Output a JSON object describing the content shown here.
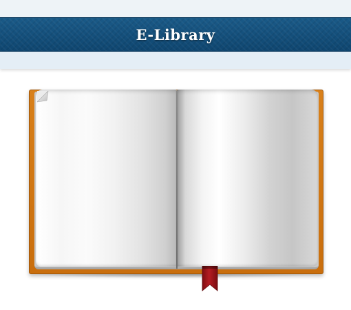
{
  "header": {
    "title": "E-Library"
  },
  "colors": {
    "header_background": "#134f7c",
    "book_cover": "#d8801a",
    "bookmark": "#a3161b"
  },
  "book": {
    "state": "open",
    "pages_blank": true
  },
  "icons": {
    "page_curl": "page-curl-icon",
    "bookmark": "bookmark-icon"
  }
}
